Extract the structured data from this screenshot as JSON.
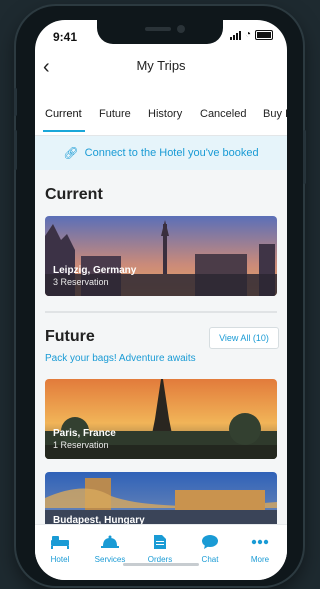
{
  "status": {
    "time": "9:41"
  },
  "header": {
    "title": "My Trips"
  },
  "tabs": [
    {
      "label": "Current"
    },
    {
      "label": "Future"
    },
    {
      "label": "History"
    },
    {
      "label": "Canceled"
    },
    {
      "label": "Buy It"
    }
  ],
  "connect": {
    "label": "Connect to the Hotel you've booked"
  },
  "current": {
    "heading": "Current",
    "card": {
      "city": "Leipzig, Germany",
      "reservations": "3 Reservation"
    }
  },
  "future": {
    "heading": "Future",
    "view_all": "View All (10)",
    "subtitle": "Pack your bags! Adventure awaits",
    "cards": [
      {
        "city": "Paris, France",
        "reservations": "1 Reservation"
      },
      {
        "city": "Budapest, Hungary",
        "reservations": ""
      }
    ]
  },
  "nav": [
    {
      "label": "Hotel",
      "icon": "bed-icon"
    },
    {
      "label": "Services",
      "icon": "bell-icon"
    },
    {
      "label": "Orders",
      "icon": "document-icon"
    },
    {
      "label": "Chat",
      "icon": "chat-icon"
    },
    {
      "label": "More",
      "icon": "more-icon"
    }
  ],
  "colors": {
    "accent": "#1a9bd5",
    "active_tab": "#1aa7d9"
  }
}
